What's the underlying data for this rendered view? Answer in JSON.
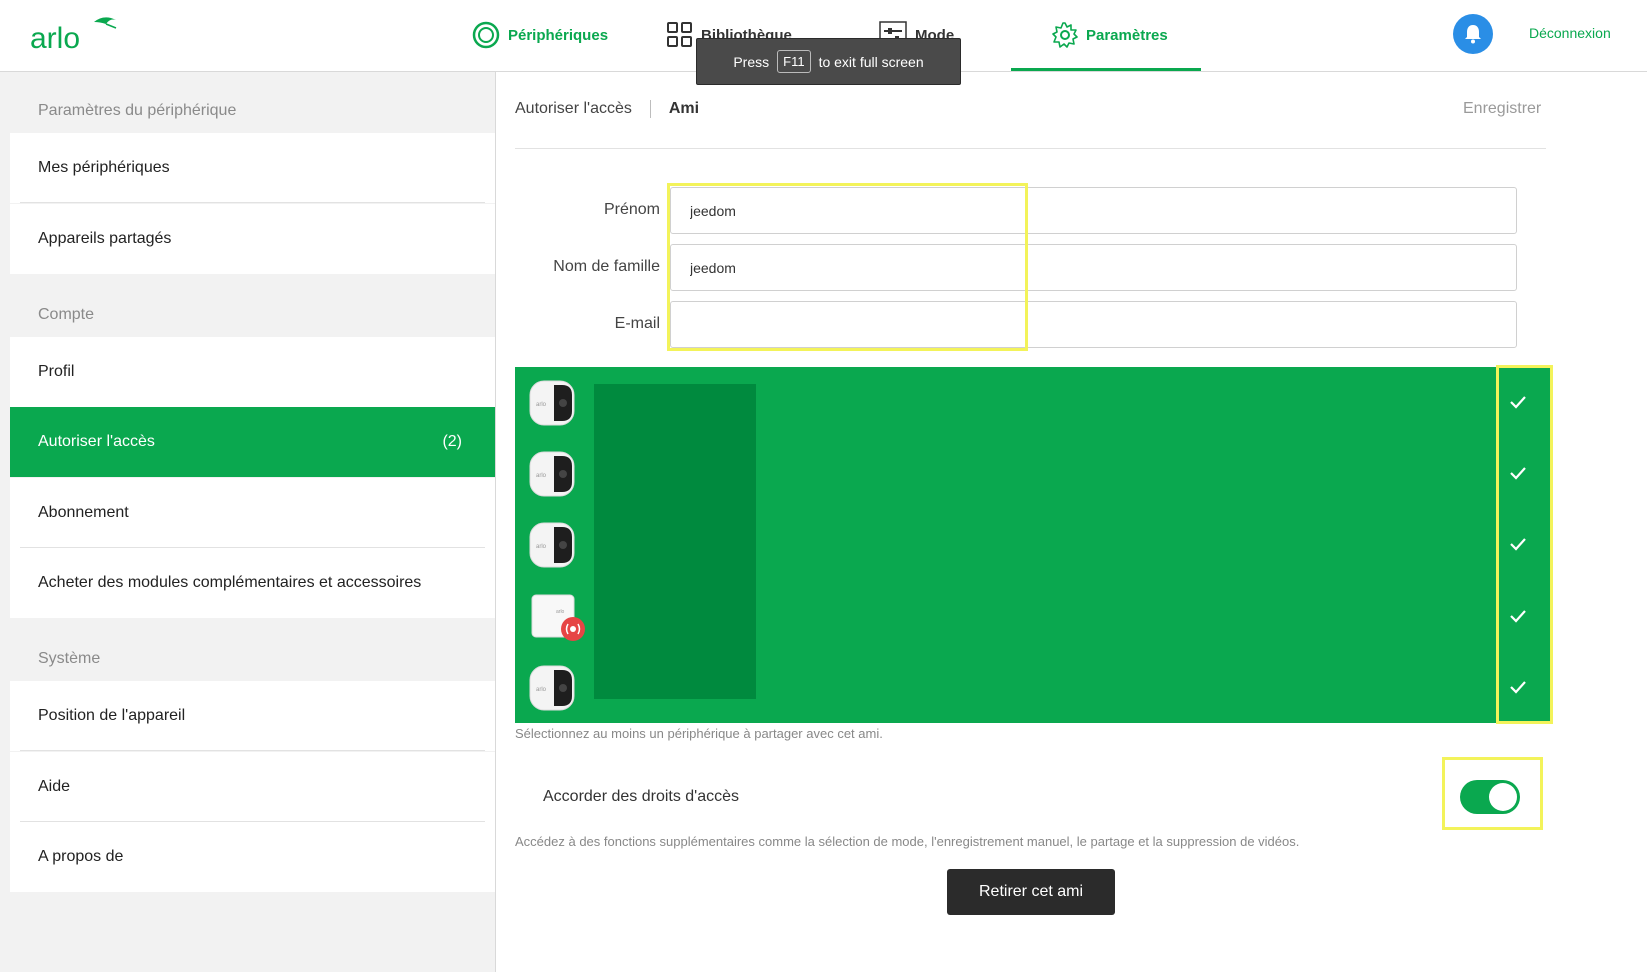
{
  "header": {
    "logo_text": "arlo",
    "nav": [
      {
        "label": "Périphériques",
        "icon": "devices-ring-icon"
      },
      {
        "label": "Bibliothèque",
        "icon": "grid-icon"
      },
      {
        "label": "Mode",
        "icon": "sliders-icon"
      },
      {
        "label": "Paramètres",
        "icon": "gear-icon"
      }
    ],
    "logout_label": "Déconnexion",
    "accent_color": "#0aa84f",
    "bell_color": "#2a8ee6"
  },
  "fullscreen_toast": {
    "press": "Press",
    "key": "F11",
    "rest": "to exit full screen"
  },
  "sidebar": {
    "device_section": "Paramètres du périphérique",
    "my_devices": "Mes périphériques",
    "shared_devices": "Appareils partagés",
    "account_section": "Compte",
    "profile": "Profil",
    "grant_access": "Autoriser l'accès",
    "grant_access_count": "(2)",
    "subscription": "Abonnement",
    "buy_addons": "Acheter des modules complémentaires et accessoires",
    "system_section": "Système",
    "device_location": "Position de l'appareil",
    "help": "Aide",
    "about": "A propos de"
  },
  "main": {
    "breadcrumb_parent": "Autoriser l'accès",
    "breadcrumb_current": "Ami",
    "save_label": "Enregistrer",
    "first_name_label": "Prénom",
    "first_name_value": "jeedom",
    "last_name_label": "Nom de famille",
    "last_name_value": "jeedom",
    "email_label": "E-mail",
    "email_value": "",
    "devices": [
      {
        "type": "camera",
        "selected": true
      },
      {
        "type": "camera",
        "selected": true
      },
      {
        "type": "camera",
        "selected": true
      },
      {
        "type": "base-station",
        "selected": true
      },
      {
        "type": "camera",
        "selected": true
      }
    ],
    "devices_helper": "Sélectionnez au moins un périphérique à partager avec cet ami.",
    "grant_rights_label": "Accorder des droits d'accès",
    "grant_rights_enabled": true,
    "grant_rights_desc": "Accédez à des fonctions supplémentaires comme la sélection de mode, l'enregistrement manuel, le partage et la suppression de vidéos.",
    "remove_friend_label": "Retirer cet ami"
  }
}
